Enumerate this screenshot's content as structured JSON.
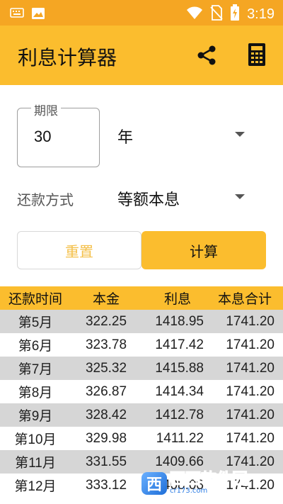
{
  "status_bar": {
    "time": "3:19",
    "icons": [
      "keyboard-icon",
      "image-icon",
      "wifi-icon",
      "no-sim-icon",
      "battery-charging-icon"
    ]
  },
  "app_bar": {
    "title": "利息计算器",
    "actions": [
      "share-icon",
      "calculator-icon"
    ]
  },
  "form": {
    "period_label": "期限",
    "period_value": "30",
    "unit": "年",
    "method_label": "还款方式",
    "method_value": "等额本息"
  },
  "buttons": {
    "reset": "重置",
    "calculate": "计算"
  },
  "table": {
    "headers": [
      "还款时间",
      "本金",
      "利息",
      "本息合计"
    ],
    "rows": [
      [
        "第5月",
        "322.25",
        "1418.95",
        "1741.20"
      ],
      [
        "第6月",
        "323.78",
        "1417.42",
        "1741.20"
      ],
      [
        "第7月",
        "325.32",
        "1415.88",
        "1741.20"
      ],
      [
        "第8月",
        "326.87",
        "1414.34",
        "1741.20"
      ],
      [
        "第9月",
        "328.42",
        "1412.78",
        "1741.20"
      ],
      [
        "第10月",
        "329.98",
        "1411.22",
        "1741.20"
      ],
      [
        "第11月",
        "331.55",
        "1409.66",
        "1741.20"
      ],
      [
        "第12月",
        "333.12",
        "1408.08",
        "1741.20"
      ]
    ]
  },
  "watermark": {
    "mark": "西",
    "text": "西西软件园",
    "sub": "cr173.com"
  },
  "colors": {
    "accent": "#fbbd2e",
    "status_bar": "#f5a623",
    "row_alt": "#d6d6d6"
  }
}
